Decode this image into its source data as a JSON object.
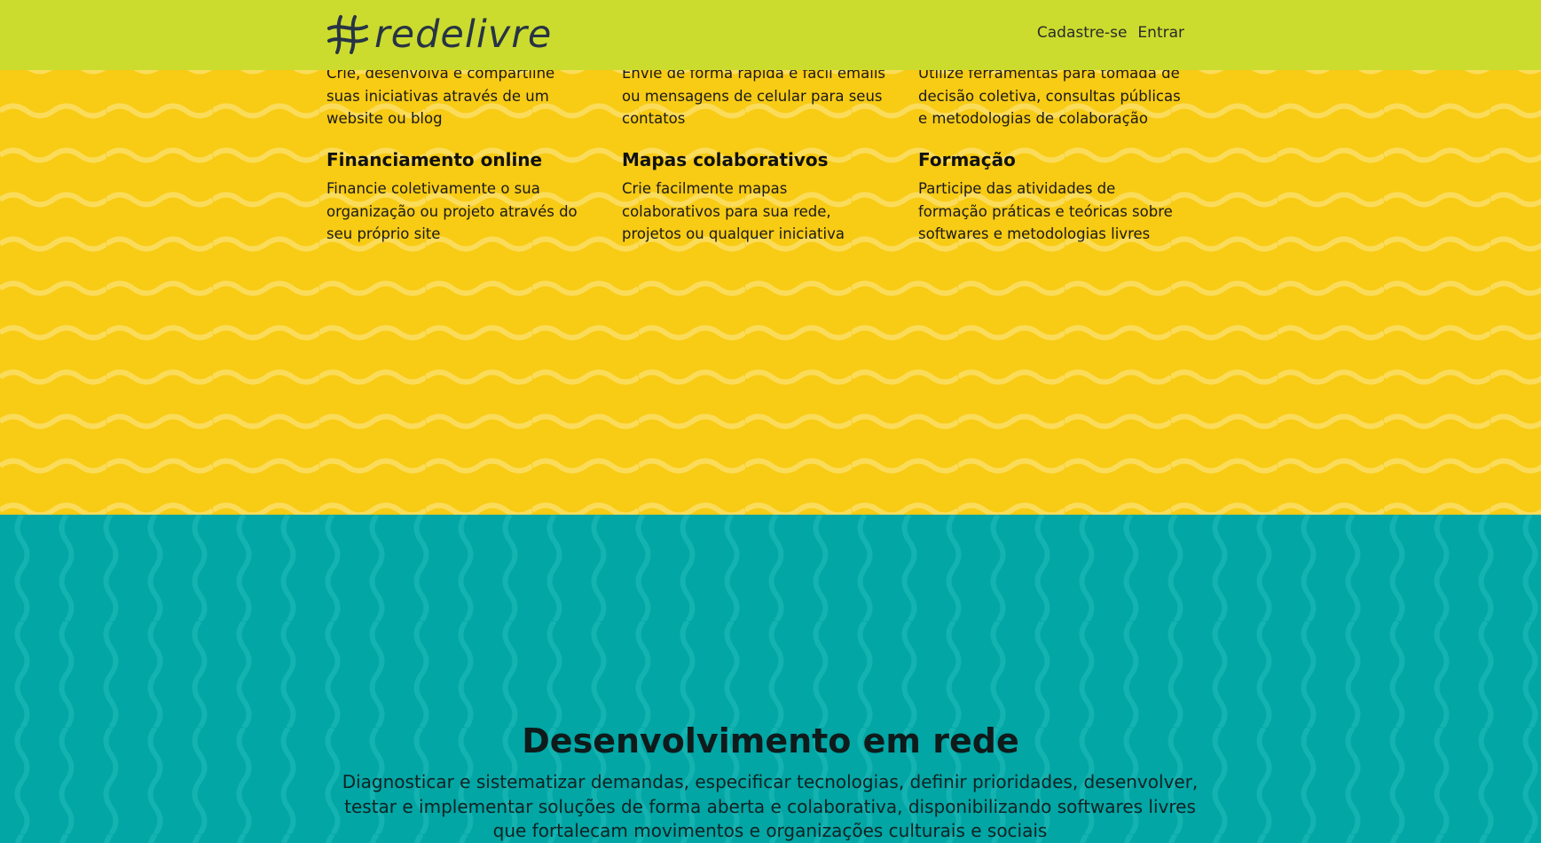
{
  "header": {
    "logo_text": "redelivre",
    "nav": {
      "signup": "Cadastre-se",
      "login": "Entrar"
    }
  },
  "features": {
    "row1": [
      {
        "title": "",
        "description": "Crie, desenvolva e compartilhe suas iniciativas através de um website ou blog"
      },
      {
        "title": "",
        "description": "Envie de forma rápida e fácil emails ou mensagens de celular para seus contatos"
      },
      {
        "title": "",
        "description": "Utilize ferramentas para tomada de decisão coletiva, consultas públicas e metodologias de colaboração"
      }
    ],
    "row2": [
      {
        "title": "Financiamento online",
        "description": "Financie coletivamente o sua organização ou projeto através do seu próprio site"
      },
      {
        "title": "Mapas colaborativos",
        "description": "Crie facilmente mapas colaborativos para sua rede, projetos ou qualquer iniciativa"
      },
      {
        "title": "Formação",
        "description": "Participe das atividades de formação práticas e teóricas sobre softwares e metodologias livres"
      }
    ]
  },
  "development": {
    "title": "Desenvolvimento em rede",
    "description": "Diagnosticar e sistematizar demandas, especificar tecnologias, definir prioridades, desenvolver, testar e implementar soluções de forma aberta e colaborativa, disponibilizando softwares livres que fortalecam movimentos e organizações culturais e sociais"
  },
  "colors": {
    "header_bg": "#cbdc2e",
    "yellow_bg": "#f8cb15",
    "teal_bg": "#01a6a5",
    "logo_color": "#283445"
  }
}
